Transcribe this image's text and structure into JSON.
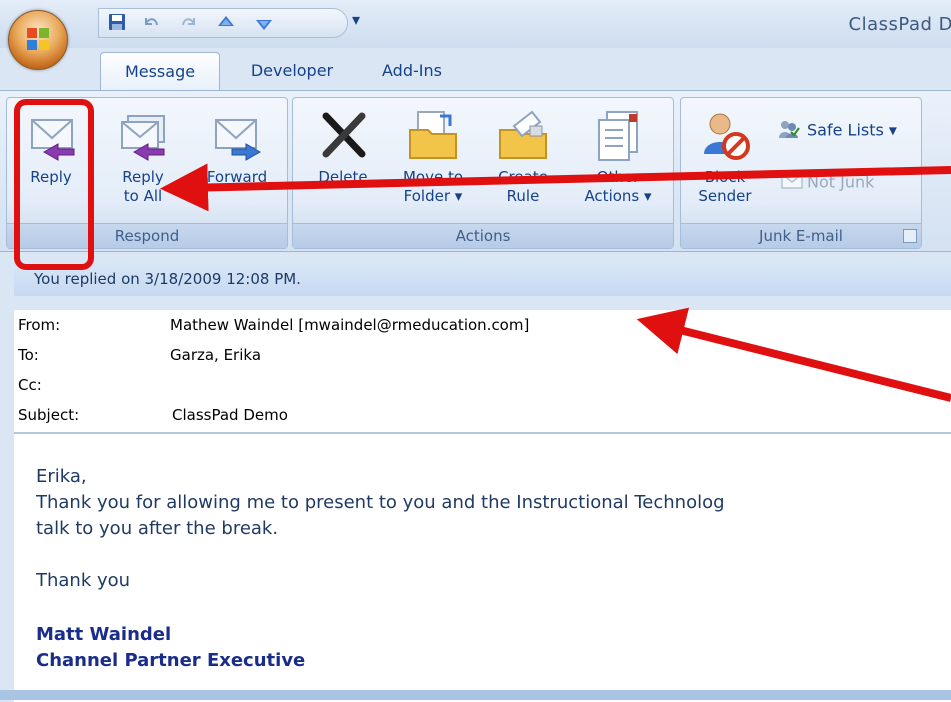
{
  "window": {
    "title": "ClassPad D"
  },
  "tabs": [
    "Message",
    "Developer",
    "Add-Ins"
  ],
  "ribbon": {
    "respond": {
      "label": "Respond",
      "reply": "Reply",
      "reply_all_line1": "Reply",
      "reply_all_line2": "to All",
      "forward": "Forward"
    },
    "actions": {
      "label": "Actions",
      "delete": "Delete",
      "move_line1": "Move to",
      "move_line2": "Folder",
      "create_line1": "Create",
      "create_line2": "Rule",
      "other_line1": "Other",
      "other_line2": "Actions"
    },
    "junk": {
      "label": "Junk E-mail",
      "block_line1": "Block",
      "block_line2": "Sender",
      "safe_lists": "Safe Lists",
      "not_junk": "Not Junk"
    }
  },
  "infobar": "You replied on 3/18/2009 12:08 PM.",
  "header": {
    "from_label": "From:",
    "from_value": "Mathew Waindel [mwaindel@rmeducation.com]",
    "to_label": "To:",
    "to_value": "Garza, Erika",
    "cc_label": "Cc:",
    "cc_value": "",
    "subject_label": "Subject:",
    "subject_value": "ClassPad Demo"
  },
  "body": {
    "greeting": "Erika,",
    "line1": "Thank you for allowing me to present to you and the Instructional Technolog",
    "line2": "talk to you after the break.",
    "thanks": "Thank you",
    "sig_name": "Matt Waindel",
    "sig_title": "Channel Partner Executive"
  },
  "colors": {
    "annotation_red": "#e01010",
    "ribbon_text": "#15428b"
  }
}
